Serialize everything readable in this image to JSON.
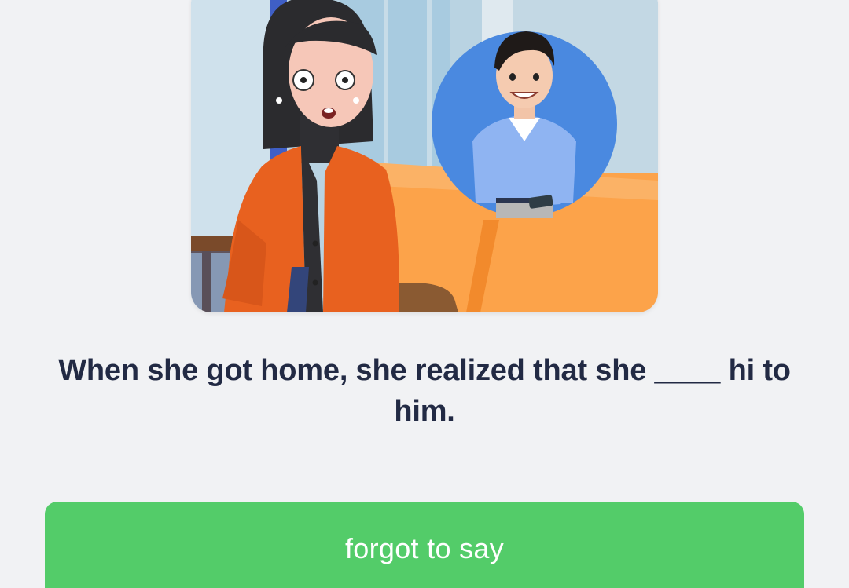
{
  "illustration": {
    "icon": "scene-woman-remembering-man-illustration"
  },
  "question": {
    "text": "When she got home, she realized that she ____ hi to him."
  },
  "options": [
    {
      "label": "forgot to say"
    }
  ],
  "colors": {
    "background": "#f1f2f4",
    "question_text": "#222a44",
    "option_background": "#53cc69",
    "option_text": "#ffffff"
  }
}
